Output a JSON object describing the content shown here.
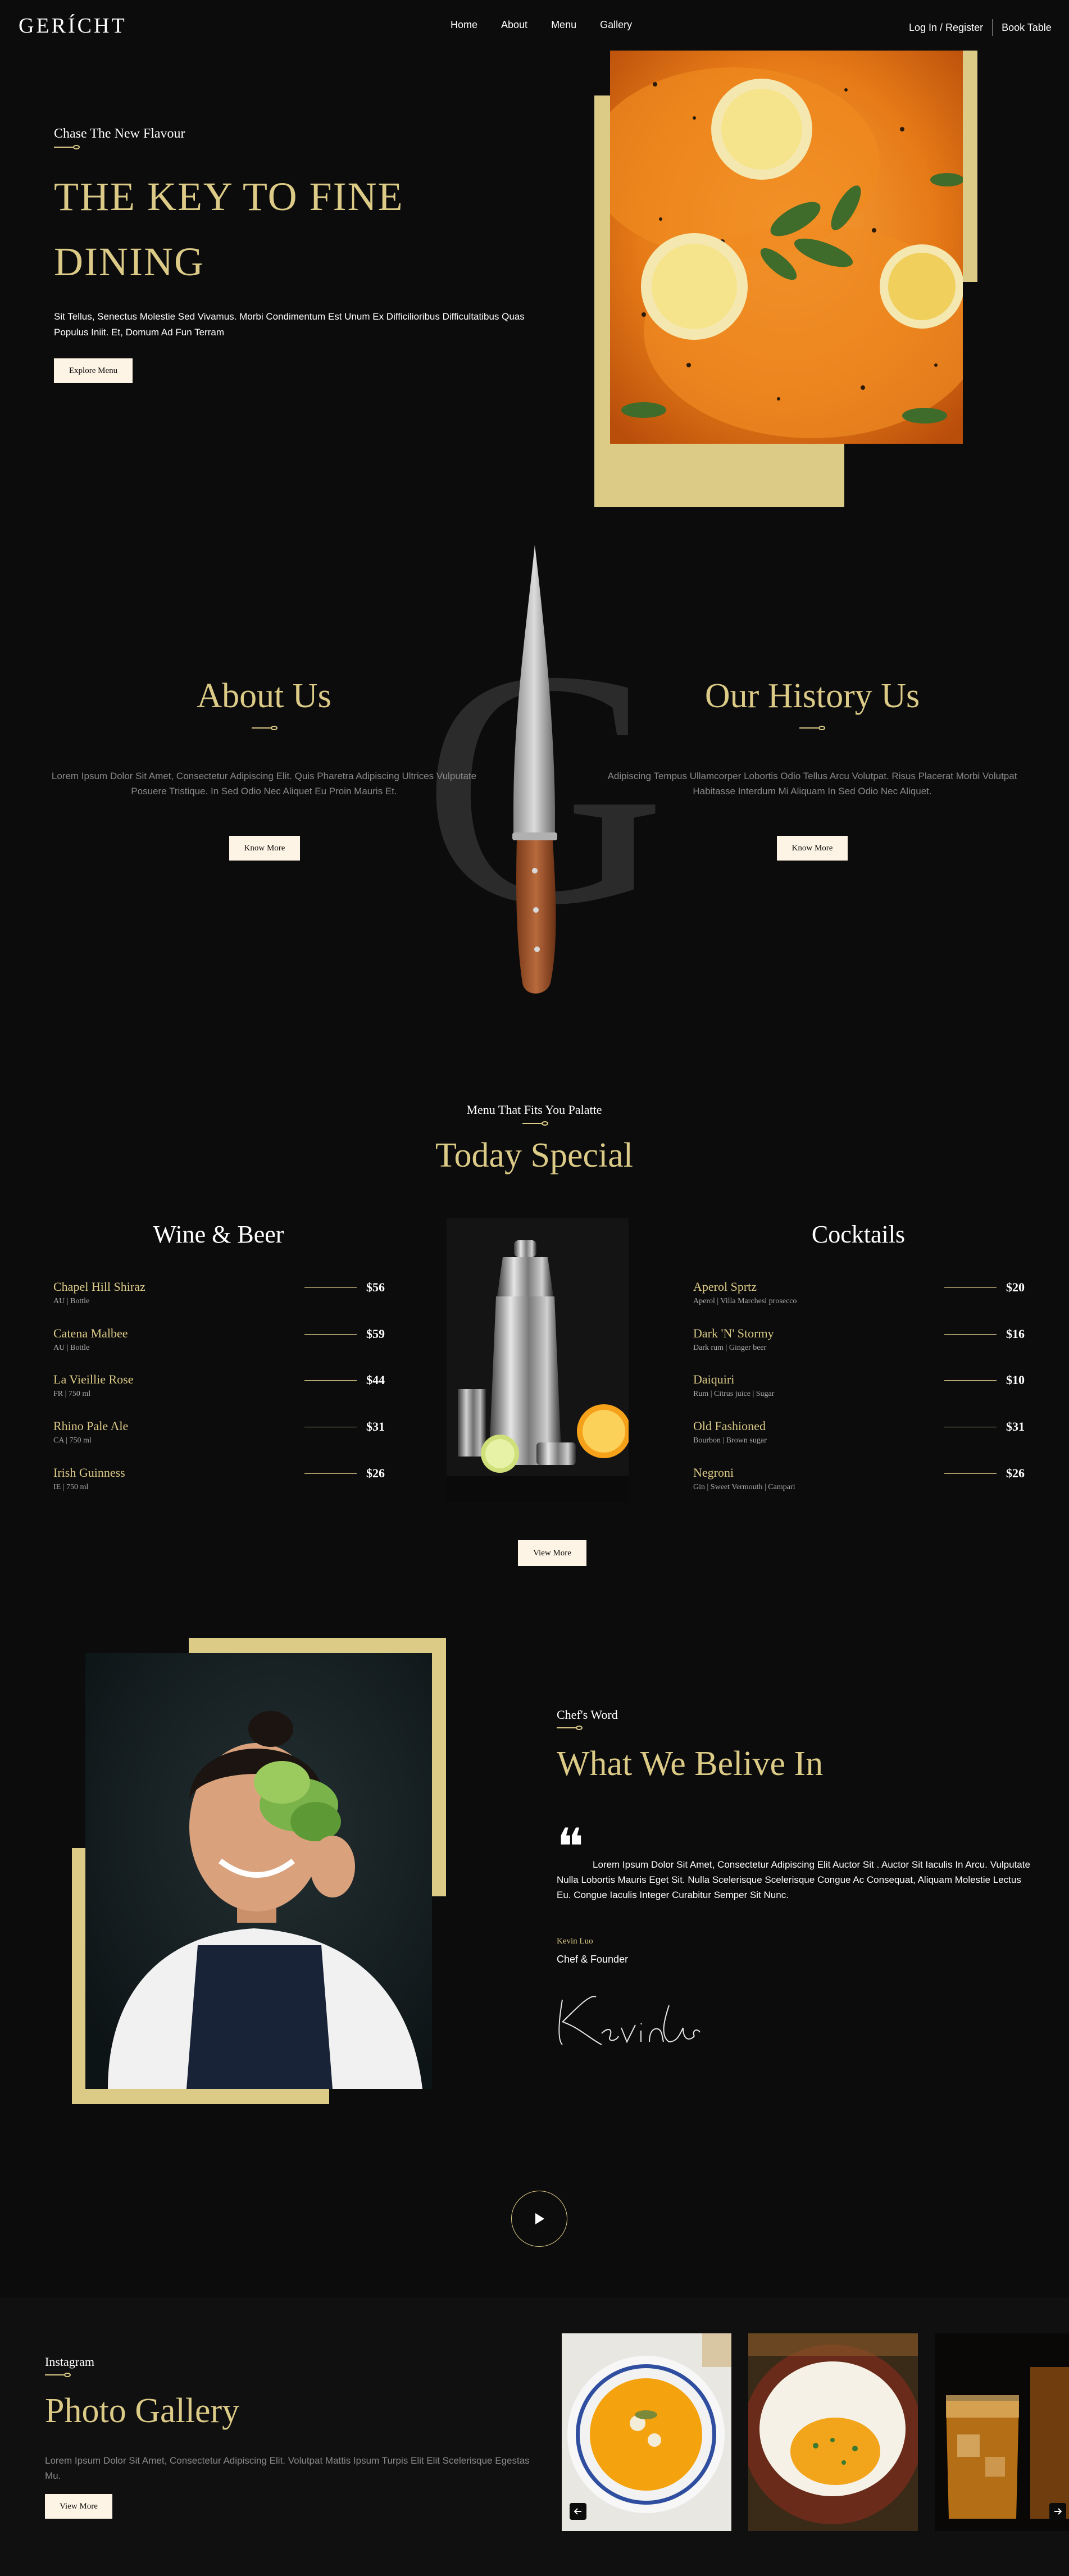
{
  "nav": {
    "logo": "GERÍCHT",
    "links": [
      "Home",
      "About",
      "Menu",
      "Gallery"
    ],
    "login": "Log In / Register",
    "book": "Book Table"
  },
  "hero": {
    "subtitle": "Chase The New Flavour",
    "title_line1": "THE KEY TO FINE",
    "title_line2": "DINING",
    "text": "Sit Tellus, Senectus Molestie Sed Vivamus. Morbi Condimentum Est Unum Ex Difficilioribus Difficultatibus Quas Populus Iniit. Et, Domum Ad Fun Terram",
    "button": "Explore Menu"
  },
  "about": {
    "watermark": "G",
    "left": {
      "title": "About Us",
      "text": "Lorem Ipsum Dolor Sit Amet, Consectetur Adipiscing Elit. Quis Pharetra Adipiscing Ultrices Vulputate Posuere Tristique. In Sed Odio Nec Aliquet Eu Proin Mauris Et.",
      "button": "Know More"
    },
    "right": {
      "title": "Our History Us",
      "text": "Adipiscing Tempus Ullamcorper Lobortis Odio Tellus Arcu Volutpat. Risus Placerat Morbi Volutpat Habitasse Interdum Mi Aliquam In Sed Odio Nec Aliquet.",
      "button": "Know More"
    }
  },
  "menu": {
    "subtitle": "Menu That Fits You Palatte",
    "title": "Today Special",
    "wine_title": "Wine & Beer",
    "cocktails_title": "Cocktails",
    "wine": [
      {
        "name": "Chapel Hill Shiraz",
        "sub": "AU | Bottle",
        "price": "$56"
      },
      {
        "name": "Catena Malbee",
        "sub": "AU | Bottle",
        "price": "$59"
      },
      {
        "name": "La Vieillie Rose",
        "sub": "FR | 750 ml",
        "price": "$44"
      },
      {
        "name": "Rhino Pale Ale",
        "sub": "CA | 750 ml",
        "price": "$31"
      },
      {
        "name": "Irish Guinness",
        "sub": "IE | 750 ml",
        "price": "$26"
      }
    ],
    "cocktails": [
      {
        "name": "Aperol Sprtz",
        "sub": "Aperol | Villa Marchesi prosecco",
        "price": "$20"
      },
      {
        "name": "Dark 'N' Stormy",
        "sub": "Dark rum | Ginger beer",
        "price": "$16"
      },
      {
        "name": "Daiquiri",
        "sub": "Rum | Citrus juice | Sugar",
        "price": "$10"
      },
      {
        "name": "Old Fashioned",
        "sub": "Bourbon | Brown sugar",
        "price": "$31"
      },
      {
        "name": "Negroni",
        "sub": "Gin | Sweet Vermouth | Campari",
        "price": "$26"
      }
    ],
    "button": "View More"
  },
  "chef": {
    "subtitle": "Chef's Word",
    "title": "What We Belive In",
    "quote": "Lorem Ipsum Dolor Sit Amet, Consectetur Adipiscing Elit Auctor Sit . Auctor Sit Iaculis In Arcu. Vulputate Nulla Lobortis Mauris Eget Sit. Nulla Scelerisque Scelerisque Congue Ac Consequat, Aliquam Molestie Lectus Eu. Congue Iaculis Integer Curabitur Semper Sit Nunc.",
    "name": "Kevin Luo",
    "role": "Chef & Founder",
    "signature": "Kevin Luo"
  },
  "gallery": {
    "subtitle": "Instagram",
    "title": "Photo Gallery",
    "text": "Lorem Ipsum Dolor Sit Amet, Consectetur Adipiscing Elit. Volutpat Mattis Ipsum Turpis Elit Elit Scelerisque Egestas Mu.",
    "button": "View More"
  },
  "colors": {
    "gold": "#dcca87",
    "background": "#0c0c0c",
    "cream": "#fef4e5"
  }
}
